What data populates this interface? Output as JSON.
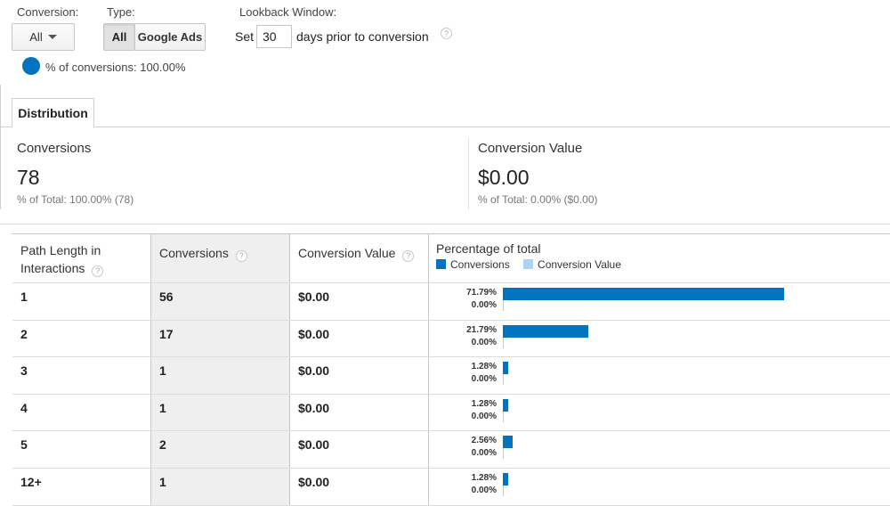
{
  "controls": {
    "conversion": {
      "label": "Conversion:",
      "value": "All"
    },
    "type": {
      "label": "Type:",
      "options": [
        "All",
        "Google Ads"
      ],
      "selected": "All"
    },
    "lookback": {
      "label": "Lookback Window:",
      "prefix": "Set",
      "value": "30",
      "suffix": "days prior to conversion",
      "help": "?"
    },
    "segment": {
      "text": "% of conversions: 100.00%",
      "color": "#0074c1"
    }
  },
  "tabs": [
    {
      "label": "Distribution",
      "active": true
    }
  ],
  "scorecards": [
    {
      "title": "Conversions",
      "value": "78",
      "subtitle": "% of Total: 100.00% (78)"
    },
    {
      "title": "Conversion Value",
      "value": "$0.00",
      "subtitle": "% of Total: 0.00% ($0.00)"
    }
  ],
  "table": {
    "headers": {
      "path_length": "Path Length in Interactions",
      "conversions": "Conversions",
      "conversion_value": "Conversion Value",
      "percentage": "Percentage of total",
      "help": "?"
    },
    "legend": [
      {
        "label": "Conversions",
        "color": "#0074c1"
      },
      {
        "label": "Conversion Value",
        "color": "#a9d4f2"
      }
    ],
    "rows": [
      {
        "path_length": "1",
        "conversions": "56",
        "conversion_value": "$0.00",
        "conv_pct_label": "71.79%",
        "value_pct_label": "0.00%",
        "conv_pct": 71.79,
        "value_pct": 0
      },
      {
        "path_length": "2",
        "conversions": "17",
        "conversion_value": "$0.00",
        "conv_pct_label": "21.79%",
        "value_pct_label": "0.00%",
        "conv_pct": 21.79,
        "value_pct": 0
      },
      {
        "path_length": "3",
        "conversions": "1",
        "conversion_value": "$0.00",
        "conv_pct_label": "1.28%",
        "value_pct_label": "0.00%",
        "conv_pct": 1.28,
        "value_pct": 0
      },
      {
        "path_length": "4",
        "conversions": "1",
        "conversion_value": "$0.00",
        "conv_pct_label": "1.28%",
        "value_pct_label": "0.00%",
        "conv_pct": 1.28,
        "value_pct": 0
      },
      {
        "path_length": "5",
        "conversions": "2",
        "conversion_value": "$0.00",
        "conv_pct_label": "2.56%",
        "value_pct_label": "0.00%",
        "conv_pct": 2.56,
        "value_pct": 0
      },
      {
        "path_length": "12+",
        "conversions": "1",
        "conversion_value": "$0.00",
        "conv_pct_label": "1.28%",
        "value_pct_label": "0.00%",
        "conv_pct": 1.28,
        "value_pct": 0
      }
    ]
  }
}
